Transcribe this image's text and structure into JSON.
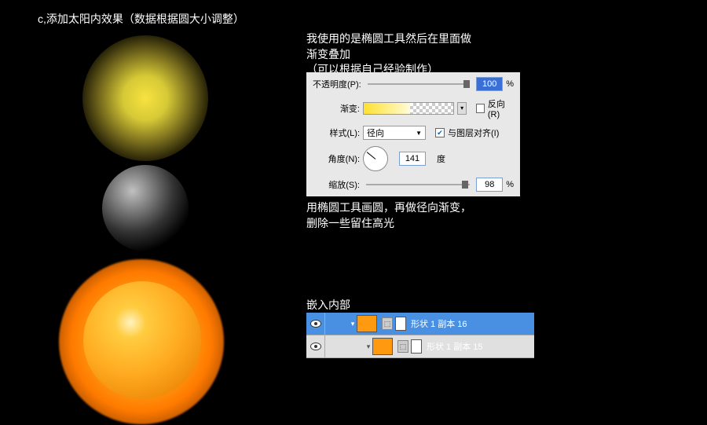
{
  "title": "c,添加太阳内效果（数据根据圆大小调整）",
  "desc1": "我使用的是椭圆工具然后在里面做\n渐变叠加\n（可以根据自己经验制作）",
  "desc2": "用椭圆工具画圆，再做径向渐变，\n删除一些留住高光",
  "desc3": "嵌入内部",
  "panel": {
    "opacity": {
      "label": "不透明度(P):",
      "value": "100",
      "unit": "%"
    },
    "gradient": {
      "label": "渐变:",
      "reverse_label": "反向(R)"
    },
    "style": {
      "label": "样式(L):",
      "value": "径向",
      "align_label": "与图层对齐(I)"
    },
    "angle": {
      "label": "角度(N):",
      "value": "141",
      "unit": "度"
    },
    "scale": {
      "label": "缩放(S):",
      "value": "98",
      "unit": "%"
    }
  },
  "layers": {
    "item1": "形状 1 副本 16",
    "item2": "形状 1 副本 15"
  }
}
